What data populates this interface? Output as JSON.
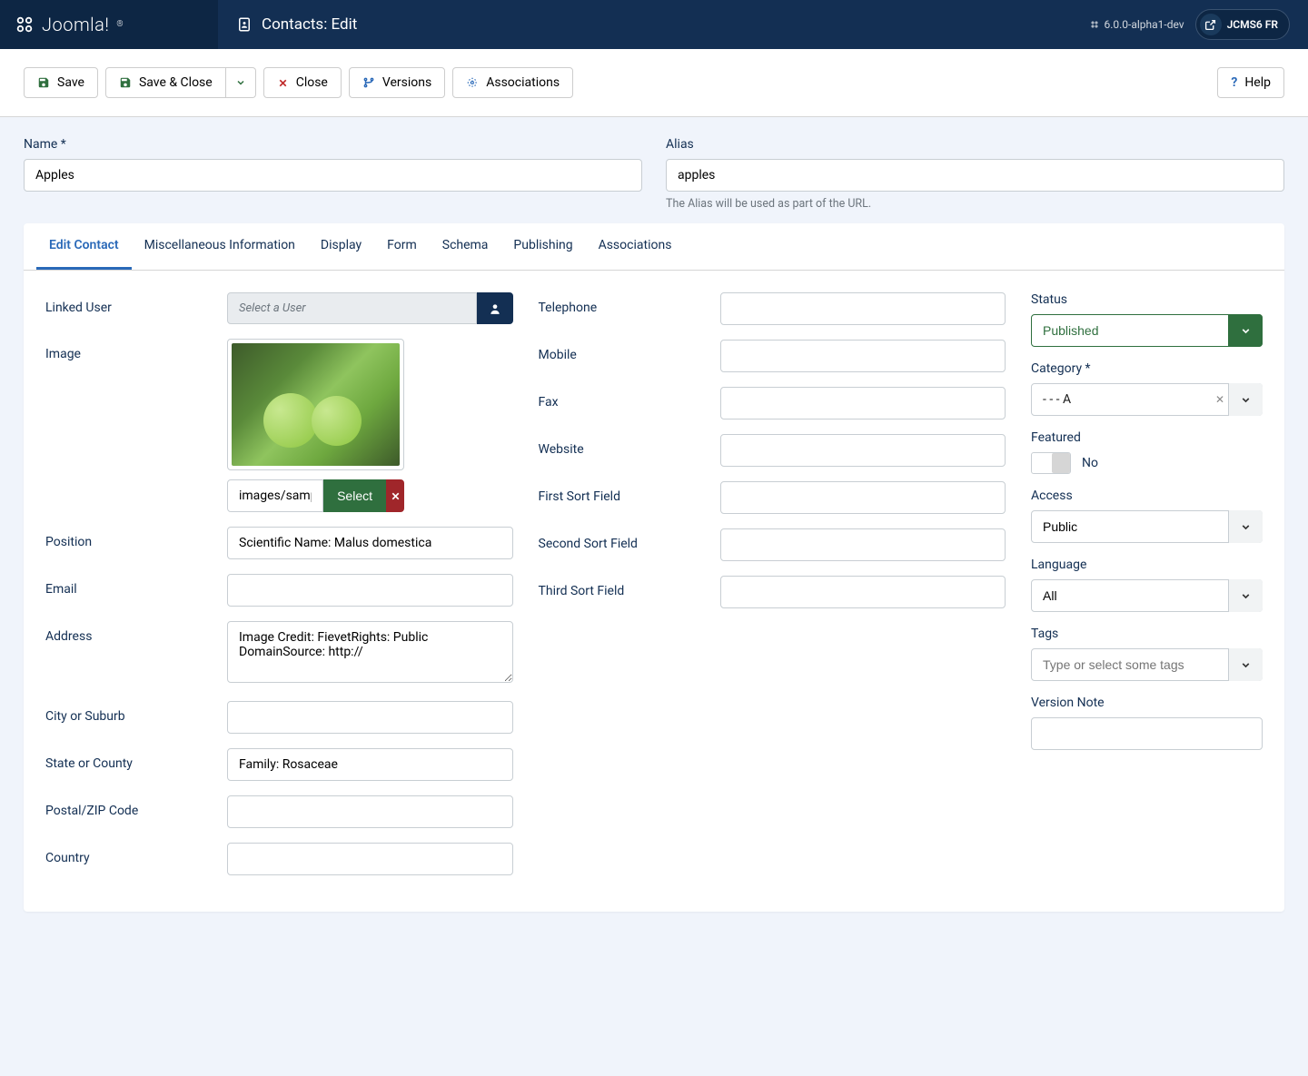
{
  "header": {
    "brand": "Joomla!",
    "title_prefix": "Contacts:",
    "title": "Edit",
    "version": "6.0.0-alpha1-dev",
    "user": "JCMS6 FR"
  },
  "toolbar": {
    "save": "Save",
    "save_close": "Save & Close",
    "close": "Close",
    "versions": "Versions",
    "associations": "Associations",
    "help": "Help"
  },
  "title_fields": {
    "name_label": "Name *",
    "name_value": "Apples",
    "alias_label": "Alias",
    "alias_value": "apples",
    "alias_hint": "The Alias will be used as part of the URL."
  },
  "tabs": [
    "Edit Contact",
    "Miscellaneous Information",
    "Display",
    "Form",
    "Schema",
    "Publishing",
    "Associations"
  ],
  "col1": {
    "linked_user_label": "Linked User",
    "linked_user_placeholder": "Select a User",
    "image_label": "Image",
    "image_path": "images/sampledata",
    "image_select": "Select",
    "position_label": "Position",
    "position_value": "Scientific Name: Malus domestica",
    "email_label": "Email",
    "email_value": "",
    "address_label": "Address",
    "address_value": "Image Credit: FievetRights: Public DomainSource: http://",
    "city_label": "City or Suburb",
    "city_value": "",
    "state_label": "State or County",
    "state_value": "Family: Rosaceae",
    "postal_label": "Postal/ZIP Code",
    "postal_value": "",
    "country_label": "Country",
    "country_value": ""
  },
  "col2": {
    "telephone": "Telephone",
    "mobile": "Mobile",
    "fax": "Fax",
    "website": "Website",
    "first_sort": "First Sort Field",
    "second_sort": "Second Sort Field",
    "third_sort": "Third Sort Field"
  },
  "side": {
    "status_label": "Status",
    "status_value": "Published",
    "category_label": "Category *",
    "category_value": "- - - A",
    "featured_label": "Featured",
    "featured_state": "No",
    "access_label": "Access",
    "access_value": "Public",
    "language_label": "Language",
    "language_value": "All",
    "tags_label": "Tags",
    "tags_placeholder": "Type or select some tags",
    "vnote_label": "Version Note"
  }
}
